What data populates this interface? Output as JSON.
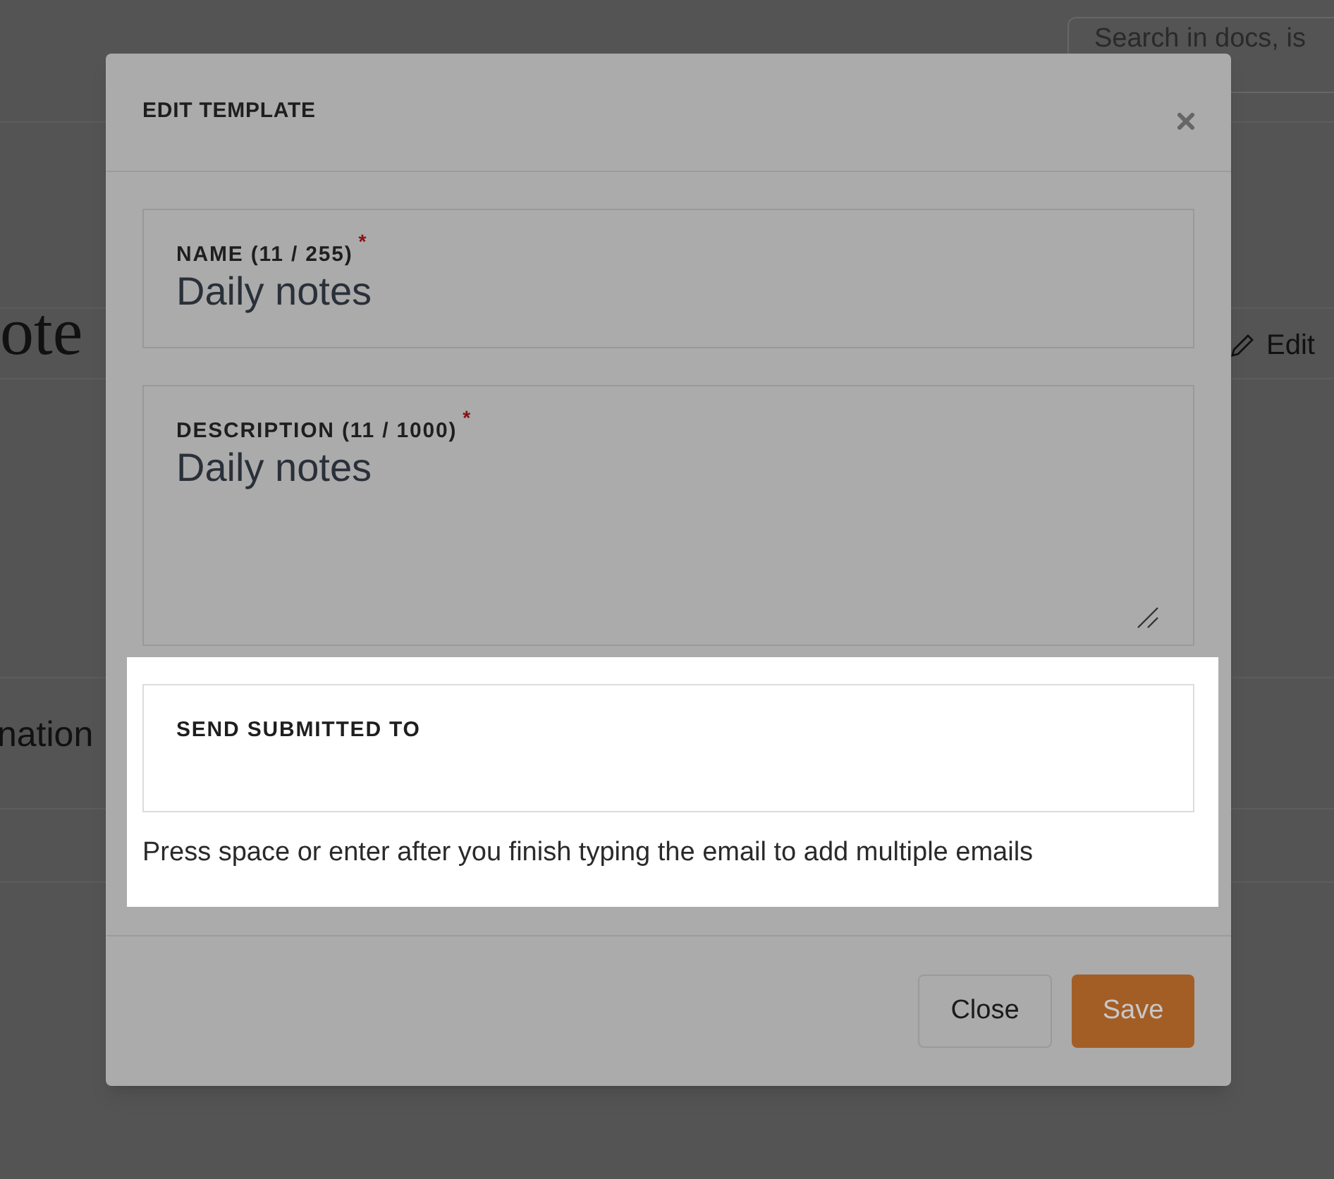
{
  "background": {
    "search": {
      "placeholder": "Search in docs, is"
    },
    "heading": "ote",
    "edit_button": "Edit",
    "row_text": "nation"
  },
  "dialog": {
    "title": "EDIT TEMPLATE",
    "fields": [
      {
        "kind": "input",
        "label": "NAME (11 / 255)",
        "required_mark": "*",
        "value": "Daily notes",
        "highlighted": false
      },
      {
        "kind": "textarea",
        "label": "DESCRIPTION (11 / 1000)",
        "required_mark": "*",
        "value": "Daily notes",
        "highlighted": false
      },
      {
        "kind": "emails",
        "label": "SEND SUBMITTED TO",
        "help": "Press space or enter after you finish typing the email to add multiple emails",
        "highlighted": true
      }
    ],
    "buttons": [
      {
        "label": "Close",
        "kind": "secondary"
      },
      {
        "label": "Save",
        "kind": "primary"
      }
    ]
  }
}
